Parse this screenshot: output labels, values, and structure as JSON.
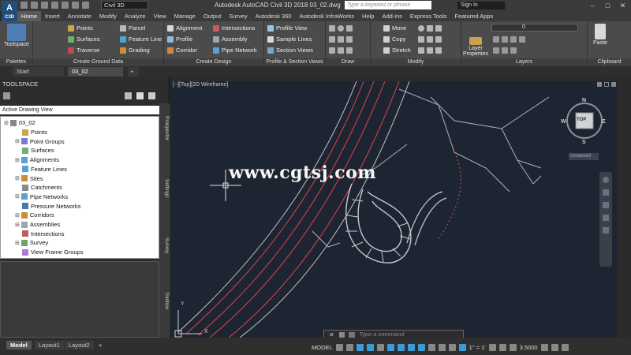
{
  "app": {
    "title": "Autodesk AutoCAD Civil 3D 2018    03_02.dwg",
    "logo_letter": "A",
    "logo_sub": "C3D",
    "workspace": "Civil 3D",
    "search_placeholder": "Type a keyword or phrase",
    "sign_in": "Sign In"
  },
  "ribbon_tabs": [
    "Home",
    "Insert",
    "Annotate",
    "Modify",
    "Analyze",
    "View",
    "Manage",
    "Output",
    "Survey",
    "Autodesk 360",
    "Autodesk InfraWorks",
    "Help",
    "Add-ins",
    "Express Tools",
    "Featured Apps"
  ],
  "ribbon": {
    "toolspace": "Toolspace",
    "palettes": "Palettes",
    "ground": {
      "title": "Create Ground Data",
      "points": "Points",
      "surfaces": "Surfaces",
      "traverse": "Traverse",
      "parcel": "Parcel",
      "feature_line": "Feature Line",
      "grading": "Grading"
    },
    "design": {
      "title": "Create Design",
      "alignment": "Alignment",
      "profile": "Profile",
      "corridor": "Corridor",
      "intersections": "Intersections",
      "assembly": "Assembly",
      "pipe_network": "Pipe Network"
    },
    "views": {
      "title": "Profile & Section Views",
      "profile_view": "Profile View",
      "sample_lines": "Sample Lines",
      "section_views": "Section Views"
    },
    "draw": {
      "title": "Draw"
    },
    "modify": {
      "title": "Modify",
      "move": "Move",
      "copy": "Copy",
      "stretch": "Stretch"
    },
    "layers": {
      "title": "Layers",
      "layer_properties": "Layer Properties",
      "layer_value": "0"
    },
    "clipboard": {
      "title": "Clipboard",
      "paste": "Paste"
    }
  },
  "doc_tabs": [
    "Start",
    "03_02"
  ],
  "toolspace": {
    "header": "TOOLSPACE",
    "view": "Active Drawing View",
    "root": "03_02",
    "items": [
      "Points",
      "Point Groups",
      "Surfaces",
      "Alignments",
      "Feature Lines",
      "Sites",
      "Catchments",
      "Pipe Networks",
      "Pressure Networks",
      "Corridors",
      "Assemblies",
      "Intersections",
      "Survey",
      "View Frame Groups"
    ],
    "side_tabs": [
      "Prospector",
      "Settings",
      "Survey",
      "Toolbox"
    ]
  },
  "viewport": {
    "label": "[−][Top][2D Wireframe]",
    "watermark": "www.cgtsj.com",
    "viewcube_top": "TOP",
    "compass": {
      "n": "N",
      "s": "S",
      "e": "E",
      "w": "W"
    },
    "ucs_name": "Unnamed",
    "ucs_x": "X",
    "ucs_y": "Y",
    "command_placeholder": "Type a command"
  },
  "status": {
    "layout_tabs": [
      "Model",
      "Layout1",
      "Layout2"
    ],
    "model": "MODEL",
    "scale": "1\" = 1'",
    "value": "3.5000"
  },
  "colors": {
    "ribbon": "#4b4b4b",
    "canvas": "#1e2532",
    "accent": "#3e9ad6",
    "road_red": "#e0424a"
  }
}
